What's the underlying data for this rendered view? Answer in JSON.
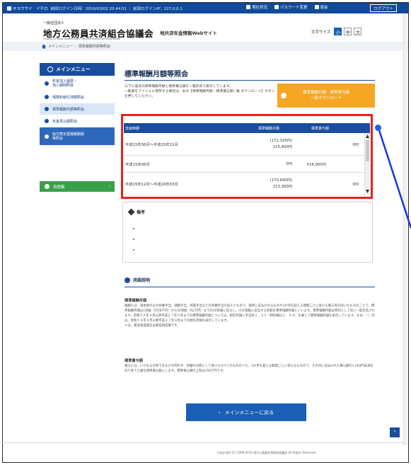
{
  "topbar": {
    "user": "キヨウサイ　イチロ",
    "login_info": "前回ログイン日時：2016/03/02 20:44:51 ｜ 前回ログインIP：127.0.0.1",
    "links": [
      "現在状況",
      "パスワード変更",
      "退会"
    ],
    "logout_label": "ログアウト"
  },
  "header": {
    "org_small": "一般社団法人",
    "org_name": "地方公務員共済組合協議会",
    "org_en": "Council of Local Government Officials Mutual Aid Association",
    "site_name": "地共済年金情報Webサイト",
    "fontsize_label": "文字サイズ",
    "fontsize_options": [
      "小",
      "中",
      "大"
    ]
  },
  "breadcrumb": [
    "メインメニュー",
    "標準報酬月額等照会"
  ],
  "sidebar": {
    "heading": "メインメニュー",
    "items": [
      {
        "label": "年金加入履歴・\n加入期間照会"
      },
      {
        "label": "保険料納付済額照会"
      },
      {
        "label": "標準報酬月額等照会"
      },
      {
        "label": "年金見込額照会"
      },
      {
        "label": "給付算定基礎報酬額\n等照会"
      }
    ],
    "glossary_label": "用語集"
  },
  "main": {
    "title": "標準報酬月額等照会",
    "intro": "以下に過去の標準報酬月額と標準賞与額を一覧形式で表示しています。\n一覧表をファイルに保存する場合は、右の【標準報酬月額・標準賞与額一覧 ダウンロード】ボタンを押してください。",
    "download_label": "標準報酬月額・標準賞与額\n一覧ダウンロード"
  },
  "table": {
    "columns": [
      "支給時期",
      "標準報酬月額",
      "標準賞与額"
    ],
    "rows": [
      {
        "period": "平成15年06月～平成15年11月",
        "monthly": "(172,320円)\n215,400円",
        "value3": "",
        "bonus": "0円"
      },
      {
        "period": "平成15年06月",
        "monthly": "0円",
        "value3": "516,000円",
        "bonus": ""
      },
      {
        "period": "平成15年12月～平成16年03月",
        "monthly": "(170,640円)\n213,300円",
        "value3": "",
        "bonus": "0円"
      }
    ]
  },
  "remarks": {
    "title": "備考"
  },
  "glossary": {
    "title": "用語説明",
    "terms": [
      {
        "name": "標準報酬月額",
        "text": "報酬とは、基本給のほか扶養手当、通勤手当、残業手当などの各種手当を加えたもので、臨時に支払われるものや3か月を超える期間ごとに受ける賞与等を除いたもののことで、標準報酬月額は1等級（9万8千円）から30等級（62万円）までの30等級に区分し、その等級に該当する金額を標準報酬月額といいます。標準報酬月額は原則として年に一度見直されます。昭和５６年４月以降平成２７年９月までの標準報酬月額については、給料月額に手当率１．２５（特別職は１．０９）を乗じて標準報酬月額を表示しています。なお、（ ）内は、昭和５６年４月以降平成２７年９月までの給料月額を表示しています。\n＊は、最高限度額又は最低限度額です。"
      },
      {
        "name": "標準賞与額",
        "text": "賞与とは、いかなる名称であるかを問わず、労働の対償として受けるすべてのもののうち、3か月を超える期間ごとに受けるものので、その月に支払われた賞与額の1,000円未満を切り捨てた額を標準賞与額とします。標準賞与額の上限は150万円です。"
      }
    ]
  },
  "back_label": "メインメニューに戻る",
  "copyright": "Copyright (C) 2009-2016 地方公務員共済組合協議会 All Rights Reserved.",
  "colors": {
    "primary": "#1a4d9e",
    "accent": "#f5a623",
    "highlight": "#e8221e",
    "marker": "#1565d8",
    "green": "#3aa14b"
  }
}
